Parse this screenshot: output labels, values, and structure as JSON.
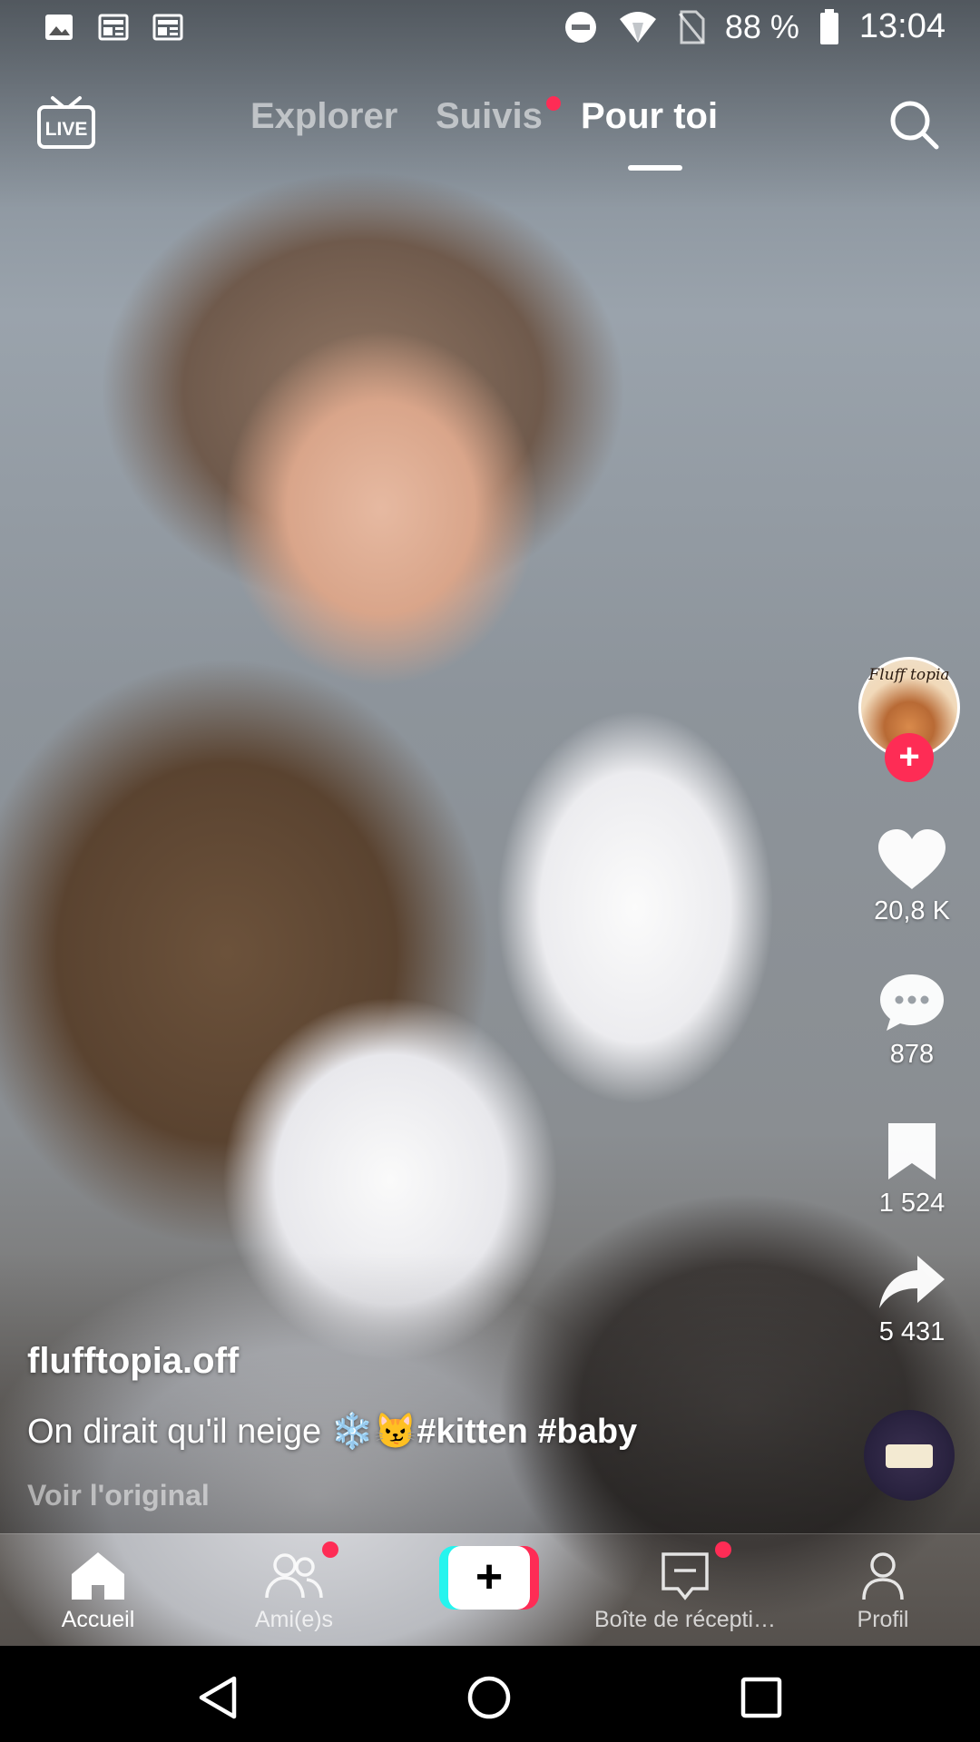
{
  "status_bar": {
    "battery_percent": "88 %",
    "time": "13:04",
    "left_icons": [
      "image-icon",
      "news-icon",
      "news-icon"
    ],
    "right_icons": [
      "do-not-disturb-icon",
      "wifi-icon",
      "no-sim-icon",
      "battery-icon"
    ]
  },
  "top_nav": {
    "live_label": "LIVE",
    "tabs": [
      {
        "label": "Explorer",
        "active": false
      },
      {
        "label": "Suivis",
        "active": false,
        "notification_dot": true
      },
      {
        "label": "Pour toi",
        "active": true
      }
    ],
    "search_icon": "search-icon"
  },
  "post": {
    "username": "flufftopia.off",
    "caption_text": "On dirait qu'il neige ❄️😼",
    "hashtags": "#kitten #baby",
    "see_original": "Voir l'original",
    "avatar_text": "Fluff topia"
  },
  "actions": {
    "likes": "20,8 K",
    "comments": "878",
    "saves": "1 524",
    "shares": "5 431"
  },
  "bottom_nav": {
    "items": [
      {
        "label": "Accueil",
        "icon": "home-icon",
        "active": true
      },
      {
        "label": "Ami(e)s",
        "icon": "friends-icon",
        "notification_dot": true
      },
      {
        "label": "",
        "icon": "plus-icon"
      },
      {
        "label": "Boîte de récepti…",
        "icon": "inbox-icon",
        "notification_dot": true
      },
      {
        "label": "Profil",
        "icon": "profile-icon"
      }
    ]
  },
  "colors": {
    "accent": "#fe2c55",
    "create_cyan": "#25f4ee"
  }
}
